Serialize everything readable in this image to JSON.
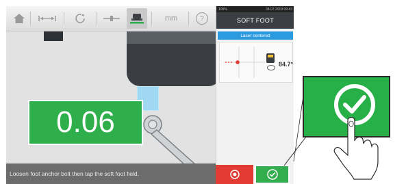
{
  "toolbar": {
    "items": [
      {
        "icon": "home-icon"
      },
      {
        "icon": "dimensions-icon"
      },
      {
        "icon": "rotate-icon"
      },
      {
        "icon": "alignment-icon"
      },
      {
        "icon": "soft-foot-icon"
      }
    ],
    "unit_label": "mm",
    "help_label": "?"
  },
  "measurement": {
    "value": "0.06"
  },
  "status_message": "Loosen foot anchor bolt then tap the soft foot field.",
  "panel": {
    "battery": "100%",
    "datetime": "24.07.2019 09:43",
    "title": "SOFT FOOT",
    "laser_status": "Laser centered",
    "inclination": "84.7°"
  },
  "actions": {
    "cancel_icon": "target-cancel-icon",
    "confirm_icon": "check-icon"
  },
  "colors": {
    "accent_green": "#2fae4c",
    "cancel_red": "#e23b34",
    "laser_blue": "#2c9adf",
    "header_dark": "#3b3e42"
  }
}
